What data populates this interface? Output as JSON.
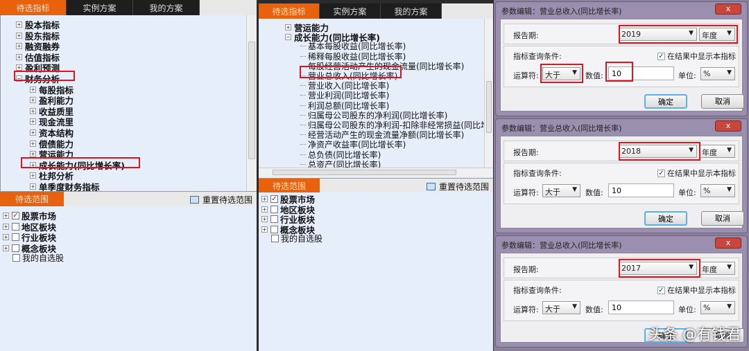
{
  "tabs": [
    "待选指标",
    "实例方案",
    "我的方案"
  ],
  "left_tree": [
    {
      "label": "股本指标",
      "level": 0,
      "exp": "+"
    },
    {
      "label": "股东指标",
      "level": 0,
      "exp": "+"
    },
    {
      "label": "融资融券",
      "level": 0,
      "exp": "+"
    },
    {
      "label": "估值指标",
      "level": 0,
      "exp": "+"
    },
    {
      "label": "盈利预测",
      "level": 0,
      "exp": "+"
    },
    {
      "label": "财务分析",
      "level": 0,
      "exp": "−"
    },
    {
      "label": "每股指标",
      "level": 1,
      "exp": "+"
    },
    {
      "label": "盈利能力",
      "level": 1,
      "exp": "+"
    },
    {
      "label": "收益质里",
      "level": 1,
      "exp": "+"
    },
    {
      "label": "现金流里",
      "level": 1,
      "exp": "+"
    },
    {
      "label": "资本结构",
      "level": 1,
      "exp": "+"
    },
    {
      "label": "偿债能力",
      "level": 1,
      "exp": "+"
    },
    {
      "label": "营运能力",
      "level": 1,
      "exp": "+"
    },
    {
      "label": "成长能力(同比增长率)",
      "level": 1,
      "exp": "+"
    },
    {
      "label": "杜邦分析",
      "level": 1,
      "exp": "+"
    },
    {
      "label": "单季度财务指标",
      "level": 1,
      "exp": "+"
    }
  ],
  "mid_tree": [
    {
      "label": "营运能力",
      "level": 1,
      "exp": "+"
    },
    {
      "label": "成长能力(同比增长率)",
      "level": 1,
      "exp": "−"
    },
    {
      "label": "基本每股收益(同比增长率)",
      "level": 2
    },
    {
      "label": "稀释每股收益(同比增长率)",
      "level": 2
    },
    {
      "label": "每股经营活动产生的现金流量(同比增长率)",
      "level": 2
    },
    {
      "label": "营业总收入(同比增长率)",
      "level": 2
    },
    {
      "label": "营业收入(同比增长率)",
      "level": 2
    },
    {
      "label": "营业利润(同比增长率)",
      "level": 2
    },
    {
      "label": "利润总额(同比增长率)",
      "level": 2
    },
    {
      "label": "归属母公司股东的净利润(同比增长率)",
      "level": 2
    },
    {
      "label": "归属母公司股东的净利润-扣除非经常损益(同比增",
      "level": 2
    },
    {
      "label": "经营活动产生的现金流量净额(同比增长率)",
      "level": 2
    },
    {
      "label": "净资产收益率(同比增长率)",
      "level": 2
    },
    {
      "label": "总负债(同比增长率)",
      "level": 2
    },
    {
      "label": "总资产(同比增长率)",
      "level": 2
    }
  ],
  "range": {
    "tab": "待选范围",
    "reset": "重置待选范围",
    "items": [
      {
        "label": "股票市场",
        "checked": true,
        "exp": true
      },
      {
        "label": "地区板块",
        "checked": false,
        "exp": true
      },
      {
        "label": "行业板块",
        "checked": false,
        "exp": true
      },
      {
        "label": "概念板块",
        "checked": false,
        "exp": true
      },
      {
        "label": "我的自选股",
        "checked": false,
        "exp": false
      }
    ]
  },
  "dialog": {
    "title": "参数编辑：营业总收入(同比增长率)",
    "close": "x",
    "period_label": "报告期:",
    "period_type": "年度",
    "cond_label": "指标查询条件:",
    "show_label": "在结果中显示本指标",
    "op_label": "运算符:",
    "op": "大于",
    "val_label": "数值:",
    "value": "10",
    "unit_label": "单位:",
    "unit": "%",
    "ok": "确定",
    "cancel": "取消"
  },
  "dialog_years": [
    "2019",
    "2018",
    "2017"
  ],
  "watermark": "头条 @有钱君"
}
